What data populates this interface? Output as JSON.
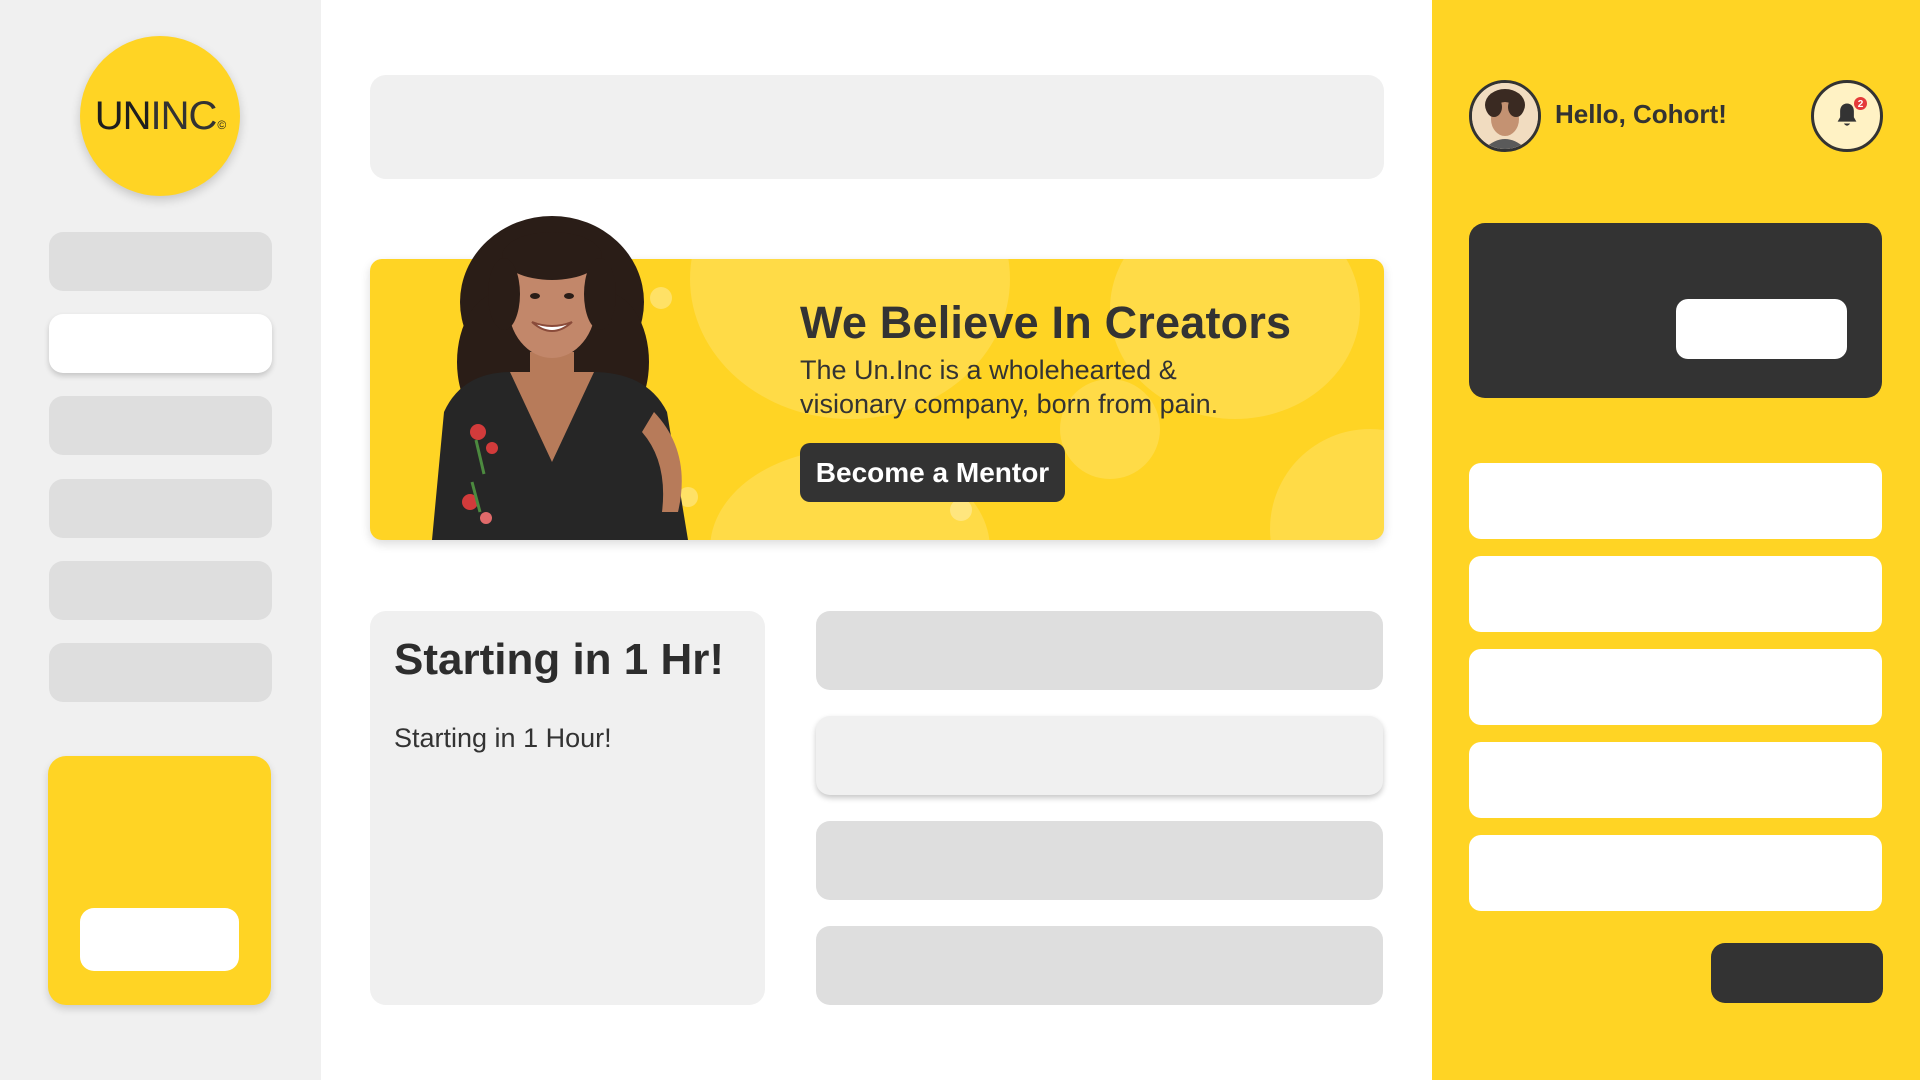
{
  "brand": {
    "logo_main": "UN",
    "logo_light": "INC",
    "logo_mark": "©",
    "color": "#ffd424"
  },
  "sidebar": {
    "nav_items": [
      {
        "active": false
      },
      {
        "active": true
      },
      {
        "active": false
      },
      {
        "active": false
      },
      {
        "active": false
      },
      {
        "active": false
      }
    ]
  },
  "banner": {
    "title": "We Believe In Creators",
    "subtitle": "The Un.Inc is a wholehearted & visionary company, born from pain.",
    "cta_label": "Become a Mentor"
  },
  "event": {
    "title": "Starting in 1 Hr!",
    "subtitle": "Starting in 1 Hour!"
  },
  "right_panel": {
    "greeting": "Hello, Cohort!",
    "notifications_count": "2"
  },
  "colors": {
    "accent": "#ffd424",
    "dark": "#333333",
    "panel_gray": "#f0f0f0",
    "skeleton": "#dedede",
    "badge": "#e43a3a"
  }
}
